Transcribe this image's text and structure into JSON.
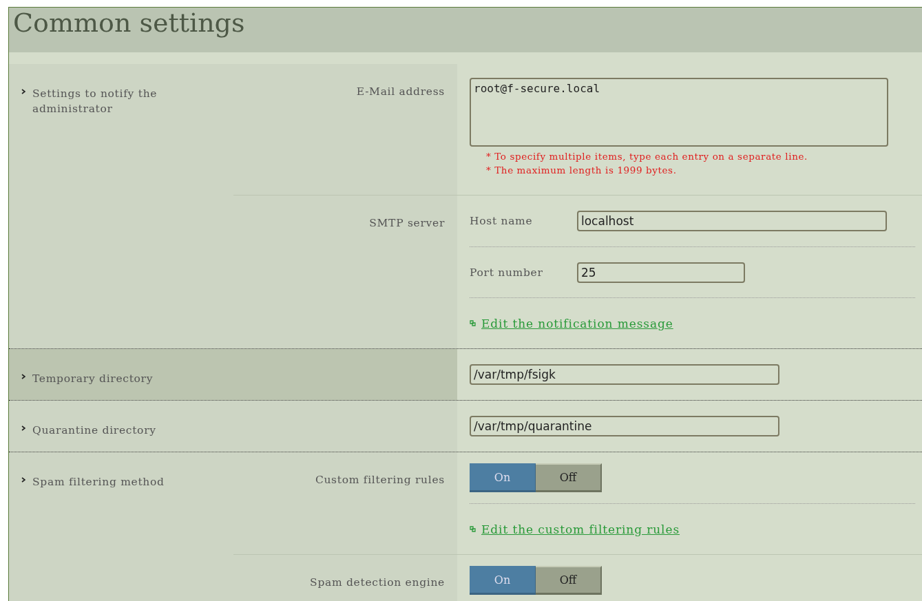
{
  "title": "Common settings",
  "sections": [
    {
      "label": "Settings to notify the administrator",
      "highlight": false,
      "rows": [
        {
          "label": "E-Mail address",
          "items": [
            {
              "kind": "textarea",
              "value": "root@f-secure.local",
              "notes": [
                "* To specify multiple items, type each entry on a separate line.",
                "* The maximum length is 1999 bytes."
              ]
            }
          ]
        },
        {
          "label": "SMTP server",
          "items": [
            {
              "kind": "field",
              "label": "Host name",
              "value": "localhost"
            },
            {
              "kind": "number",
              "label": "Port number",
              "value": "25"
            },
            {
              "kind": "link",
              "text": "Edit the notification message"
            }
          ]
        }
      ]
    },
    {
      "label": "Temporary directory",
      "highlight": true,
      "rows": [
        {
          "items": [
            {
              "kind": "field",
              "value": "/var/tmp/fsigk"
            }
          ]
        }
      ]
    },
    {
      "label": "Quarantine directory",
      "highlight": false,
      "rows": [
        {
          "items": [
            {
              "kind": "field",
              "value": "/var/tmp/quarantine"
            }
          ]
        }
      ]
    },
    {
      "label": "Spam filtering method",
      "highlight": false,
      "rows": [
        {
          "label": "Custom filtering rules",
          "items": [
            {
              "kind": "toggle",
              "options": [
                {
                  "label": "On",
                  "selected": true
                },
                {
                  "label": "Off",
                  "selected": false
                }
              ]
            },
            {
              "kind": "link",
              "text": "Edit the custom filtering rules"
            }
          ]
        },
        {
          "label": "Spam detection engine",
          "items": [
            {
              "kind": "toggle",
              "options": [
                {
                  "label": "On",
                  "selected": true
                },
                {
                  "label": "Off",
                  "selected": false
                }
              ]
            }
          ]
        }
      ]
    }
  ]
}
